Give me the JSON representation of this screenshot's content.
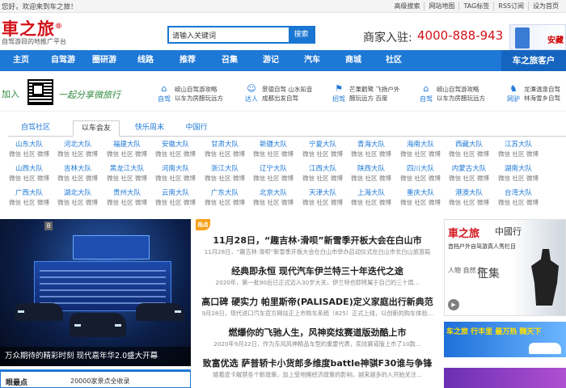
{
  "topbar": {
    "welcome": "您好，欢迎来到车之旅！",
    "links": [
      "高级搜索",
      "网站地图",
      "TAG标签",
      "RSS订阅",
      "设为首页"
    ]
  },
  "header": {
    "logo": "車之旅",
    "logo_mark": "®",
    "logo_sub": "自驾游目的地推广平台",
    "search_placeholder": "请输入关键词",
    "search_button": "搜索",
    "merchant_label": "商家入驻:",
    "phone": "4000-888-943",
    "ad_text": "安藏"
  },
  "nav": {
    "items": [
      "主页",
      "自驾游",
      "圈研游",
      "线路",
      "推荐",
      "召集",
      "游记",
      "汽车",
      "商城",
      "社区"
    ],
    "right_label": "车之旅客户"
  },
  "promo": {
    "join": "加入",
    "slogan": "一起分享微旅行",
    "items": [
      {
        "icon": "自驾",
        "line1": "崂山自驾游攻略",
        "line2": "以车为房醋玩远方"
      },
      {
        "icon": "达人",
        "line1": "景德自驾 山水知音",
        "line2": "成都出发自驾"
      },
      {
        "icon": "招驾",
        "line1": "芒果鹳鹭 飞扬户外",
        "line2": "醋玩远方 百度"
      },
      {
        "icon": "自驾",
        "line1": "崂山自驾游攻略",
        "line2": "以车为房醋玩远方"
      },
      {
        "icon": "网驴",
        "line1": "龙潭温泉自驾",
        "line2": "林海雪乡自驾"
      }
    ]
  },
  "community": {
    "tabs": [
      "自驾社区",
      "以车会友",
      "快乐周末",
      "中国行"
    ],
    "active_tab": 1,
    "sub_links": "微信 社区 微博",
    "teams": [
      [
        "山东大队",
        "河北大队",
        "福建大队",
        "安徽大队",
        "甘肃大队",
        "新疆大队",
        "宁夏大队",
        "青海大队",
        "海南大队",
        "西藏大队",
        "江苏大队"
      ],
      [
        "山西大队",
        "吉林大队",
        "黑龙江大队",
        "河南大队",
        "浙江大队",
        "辽宁大队",
        "江西大队",
        "陕西大队",
        "四川大队",
        "内蒙古大队",
        "湖南大队"
      ],
      [
        "广西大队",
        "湖北大队",
        "贵州大队",
        "云南大队",
        "广东大队",
        "北京大队",
        "天津大队",
        "上海大队",
        "重庆大队",
        "港澳大队",
        "台湾大队"
      ]
    ]
  },
  "slider": {
    "index": "8",
    "caption": "万众期待的精彩时刻 现代嘉年华2.0盛大开幕"
  },
  "news": {
    "hot_badge": "热点",
    "items": [
      {
        "title": "11月28日，“趣吉林·滑呗”新雪季开板大会在白山市",
        "desc": "11月28日，“趣吉林·滑呗”新雪季开板大会在白山市举办启动仪式在白山市长白山旅游局"
      },
      {
        "title": "经典即永恒 现代汽车伊兰特三十年迭代之途",
        "desc": "2020年，第一批90后已正式迈入30岁大关，伊兰特也即将属于自己的三十周..."
      },
      {
        "title": "高口碑 硬实力 帕里斯帝(PALISADE)定义家庭出行新典范",
        "desc": "9月28日，现代进口汽车官方网站正上市购车系统（825）正式上线，以创新的购车体验..."
      },
      {
        "title": "燃爆你的飞驰人生，风神奕炫赛道版劲酷上市",
        "desc": "2020年9月22日，作为东风风神精品车型的重要代表，奕炫赛道版上市了10款..."
      },
      {
        "title": "致富优选 萨普轿卡小货郎多维度battle神骐F30谁与争锋",
        "desc": "随着皮卡解禁各个新政策，加上受地摊经济政策的影响，越来越多的人开始关注..."
      }
    ]
  },
  "ads": {
    "brand": "車之旅",
    "brand2": "中國行",
    "subtitle": "首档户外自驾游真人秀栏目",
    "left_text": "人物 自然 路",
    "right_text": "征集",
    "banner2_a": "车之旅 行丰里 ",
    "banner2_b": "最万热 魏天下"
  },
  "sidecard": {
    "title": "眼最点",
    "text": "20000家景点全收录"
  }
}
